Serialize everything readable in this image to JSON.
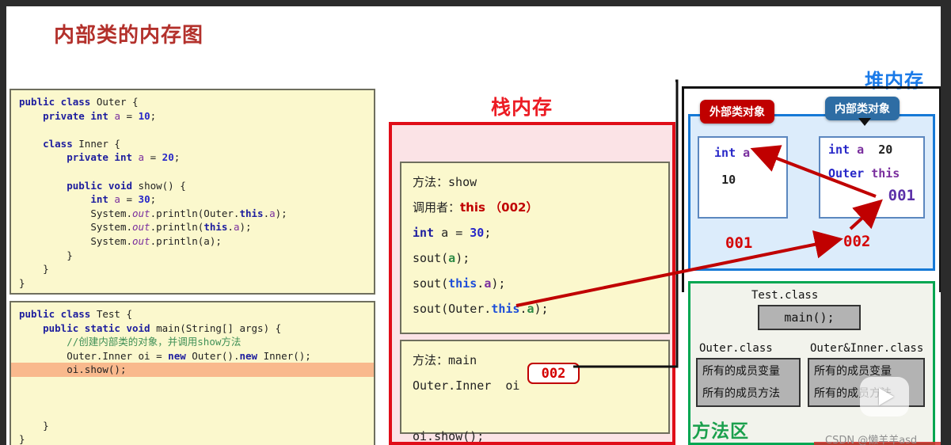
{
  "page": {
    "title": "内部类的内存图"
  },
  "code_blocks": [
    {
      "name": "outer-class-source",
      "lines": [
        "public class Outer {",
        "    private int a = 10;",
        "",
        "    class Inner {",
        "        private int a = 20;",
        "",
        "        public void show() {",
        "            int a = 30;",
        "            System.out.println(Outer.this.a);",
        "            System.out.println(this.a);",
        "            System.out.println(a);",
        "        }",
        "    }",
        "}"
      ]
    },
    {
      "name": "test-class-source",
      "lines": [
        "public class Test {",
        "    public static void main(String[] args) {",
        "        //创建内部类的对象，并调用show方法",
        "        Outer.Inner oi = new Outer().new Inner();",
        "",
        "        oi.show();",
        "",
        "",
        "    }",
        "}"
      ],
      "highlighted_line": "        oi.show();"
    }
  ],
  "stack": {
    "title": "栈内存",
    "color": "#ec1c24",
    "frames": [
      {
        "name": "show-frame",
        "method_label": "方法：",
        "method_name": "show",
        "caller_label": "调用者：",
        "caller_value": "this （002）",
        "lines": [
          "int a = 30;",
          "sout(a);",
          "sout(this.a);",
          "sout(Outer.this.a);"
        ]
      },
      {
        "name": "main-frame",
        "method_label": "方法：",
        "method_name": "main",
        "variable_type": "Outer.Inner",
        "variable_name": "oi",
        "variable_value": "002",
        "lines": [
          "oi.show();"
        ]
      }
    ]
  },
  "heap": {
    "title": "堆内存",
    "color": "#1a7ae8",
    "badges": {
      "outer": "外部类对象",
      "outer_color": "#c00000",
      "inner": "内部类对象",
      "inner_color": "#2e6da4"
    },
    "outer_object": {
      "field": "int a",
      "value": "10",
      "address": "001"
    },
    "inner_object": {
      "field": "int a",
      "value": "20",
      "ref_field": "Outer this",
      "ref_value": "001",
      "address": "002"
    }
  },
  "method_area": {
    "title": "方法区",
    "color": "#1ba04d",
    "classes": [
      {
        "name": "Test.class",
        "members": [
          "main();"
        ]
      },
      {
        "name": "Outer.class",
        "members": [
          "所有的成员变量",
          "所有的成员方法"
        ]
      },
      {
        "name": "Outer&Inner.class",
        "members": [
          "所有的成员变量",
          "所有的成员方法"
        ]
      }
    ]
  },
  "overlay": {
    "watermark": "CSDN @懒羊羊asd",
    "play_icon": "play-icon"
  }
}
